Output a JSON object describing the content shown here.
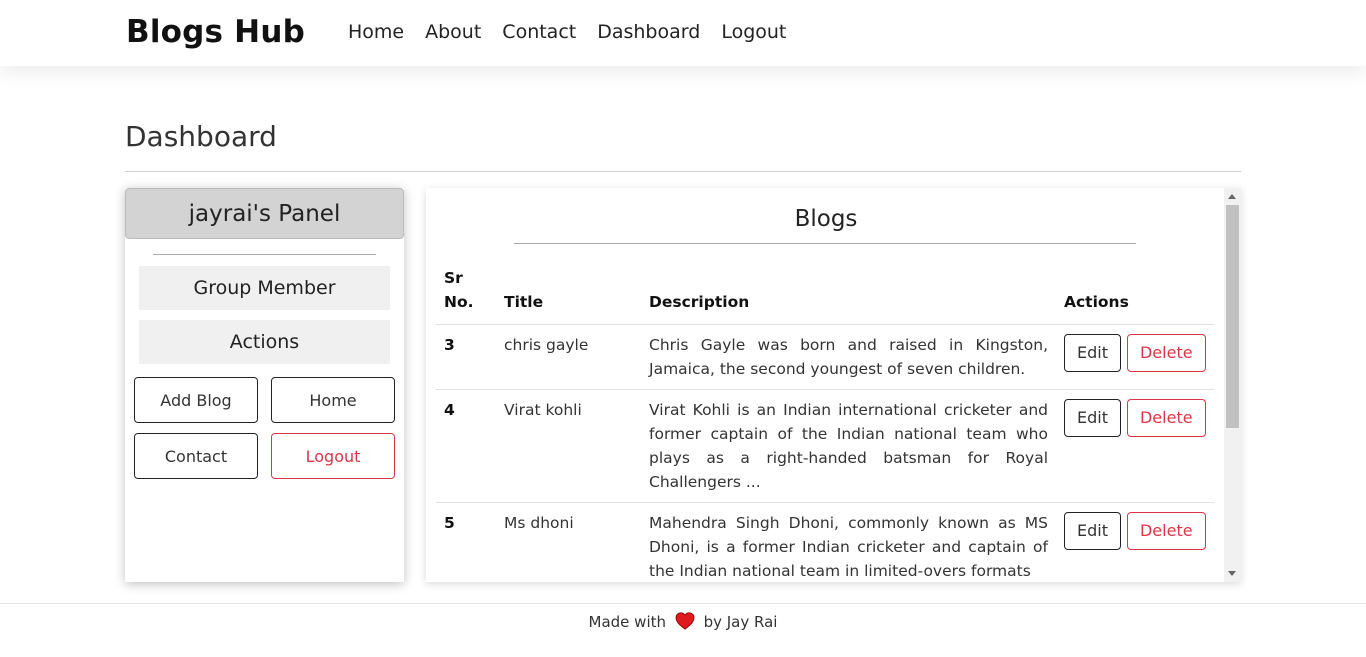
{
  "navbar": {
    "brand": "Blogs Hub",
    "links": [
      "Home",
      "About",
      "Contact",
      "Dashboard",
      "Logout"
    ]
  },
  "page": {
    "title": "Dashboard"
  },
  "panel": {
    "title": "jayrai's Panel",
    "sections": {
      "group": "Group Member",
      "actions": "Actions"
    },
    "buttons": {
      "add_blog": "Add Blog",
      "home": "Home",
      "contact": "Contact",
      "logout": "Logout"
    }
  },
  "blogs": {
    "title": "Blogs",
    "headers": {
      "sr": "Sr No.",
      "title": "Title",
      "description": "Description",
      "actions": "Actions"
    },
    "edit_label": "Edit",
    "delete_label": "Delete",
    "rows": [
      {
        "sr": "3",
        "title": "chris gayle",
        "description": "Chris Gayle was born and raised in Kingston, Jamaica, the second youngest of seven children."
      },
      {
        "sr": "4",
        "title": "Virat kohli",
        "description": "Virat Kohli is an Indian international cricketer and former captain of the Indian national team who plays as a right-handed batsman for Royal Challengers ..."
      },
      {
        "sr": "5",
        "title": "Ms dhoni",
        "description": "Mahendra Singh Dhoni, commonly known as MS Dhoni, is a former Indian cricketer and captain of the Indian national team in limited-overs formats"
      }
    ]
  },
  "footer": {
    "prefix": "Made with",
    "suffix": "by Jay Rai",
    "heart_color": "#e0191f"
  },
  "colors": {
    "danger": "#dc3545",
    "panel_header": "#d3d3d3"
  }
}
